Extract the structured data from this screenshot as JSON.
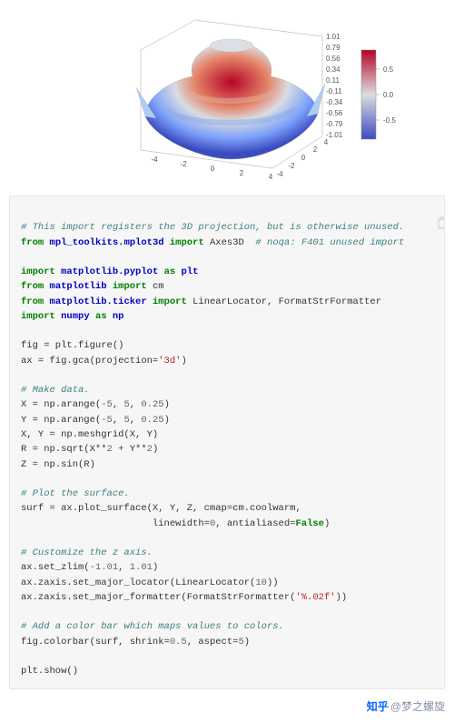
{
  "chart_data": {
    "type": "surface3d",
    "z_ticks": [
      "1.01",
      "0.79",
      "0.56",
      "0.34",
      "0.11",
      "-0.11",
      "-0.34",
      "-0.56",
      "-0.79",
      "-1.01"
    ],
    "x_ticks": [
      "-4",
      "-2",
      "0",
      "2",
      "4"
    ],
    "y_ticks": [
      "-4",
      "-2",
      "0",
      "2",
      "4"
    ],
    "colorbar_ticks": [
      "0.5",
      "0.0",
      "-0.5"
    ],
    "colormap": "coolwarm",
    "zlim": [
      -1.01,
      1.01
    ],
    "x_range": [
      -5,
      5
    ],
    "y_range": [
      -5,
      5
    ],
    "step": 0.25,
    "formula": "Z = sin( sqrt(X^2 + Y^2) )"
  },
  "code": {
    "c0": "# This import registers the 3D projection, but is otherwise unused.",
    "l1a": "from",
    "l1b": "mpl_toolkits.mplot3d",
    "l1c": "import",
    "l1d": "Axes3D",
    "c1": "# noqa: F401 unused import",
    "l2a": "import",
    "l2b": "matplotlib.pyplot",
    "l2c": "as",
    "l2d": "plt",
    "l3a": "from",
    "l3b": "matplotlib",
    "l3c": "import",
    "l3d": "cm",
    "l4a": "from",
    "l4b": "matplotlib.ticker",
    "l4c": "import",
    "l4d": "LinearLocator, FormatStrFormatter",
    "l5a": "import",
    "l5b": "numpy",
    "l5c": "as",
    "l5d": "np",
    "l6": "fig = plt.figure()",
    "l7a": "ax = fig.gca(projection=",
    "l7b": "'3d'",
    "l7c": ")",
    "c8": "# Make data.",
    "l9a": "X = np.arange(",
    "l9b": "-5",
    "l9c": ", ",
    "l9d": "5",
    "l9e": ", ",
    "l9f": "0.25",
    "l9g": ")",
    "l10a": "Y = np.arange(",
    "l10b": "-5",
    "l10c": ", ",
    "l10d": "5",
    "l10e": ", ",
    "l10f": "0.25",
    "l10g": ")",
    "l11": "X, Y = np.meshgrid(X, Y)",
    "l12a": "R = np.sqrt(X**",
    "l12b": "2",
    "l12c": " + Y**",
    "l12d": "2",
    "l12e": ")",
    "l13": "Z = np.sin(R)",
    "c14": "# Plot the surface.",
    "l15": "surf = ax.plot_surface(X, Y, Z, cmap=cm.coolwarm,",
    "l16a": "                       linewidth=",
    "l16b": "0",
    "l16c": ", antialiased=",
    "l16d": "False",
    "l16e": ")",
    "c17": "# Customize the z axis.",
    "l18a": "ax.set_zlim(",
    "l18b": "-1.01",
    "l18c": ", ",
    "l18d": "1.01",
    "l18e": ")",
    "l19a": "ax.zaxis.set_major_locator(LinearLocator(",
    "l19b": "10",
    "l19c": "))",
    "l20a": "ax.zaxis.set_major_formatter(FormatStrFormatter(",
    "l20b": "'%.02f'",
    "l20c": "))",
    "c21": "# Add a color bar which maps values to colors.",
    "l22a": "fig.colorbar(surf, shrink=",
    "l22b": "0.5",
    "l22c": ", aspect=",
    "l22d": "5",
    "l22e": ")",
    "l23": "plt.show()"
  },
  "footer": {
    "logo": "知乎",
    "author": "@梦之螺旋"
  }
}
